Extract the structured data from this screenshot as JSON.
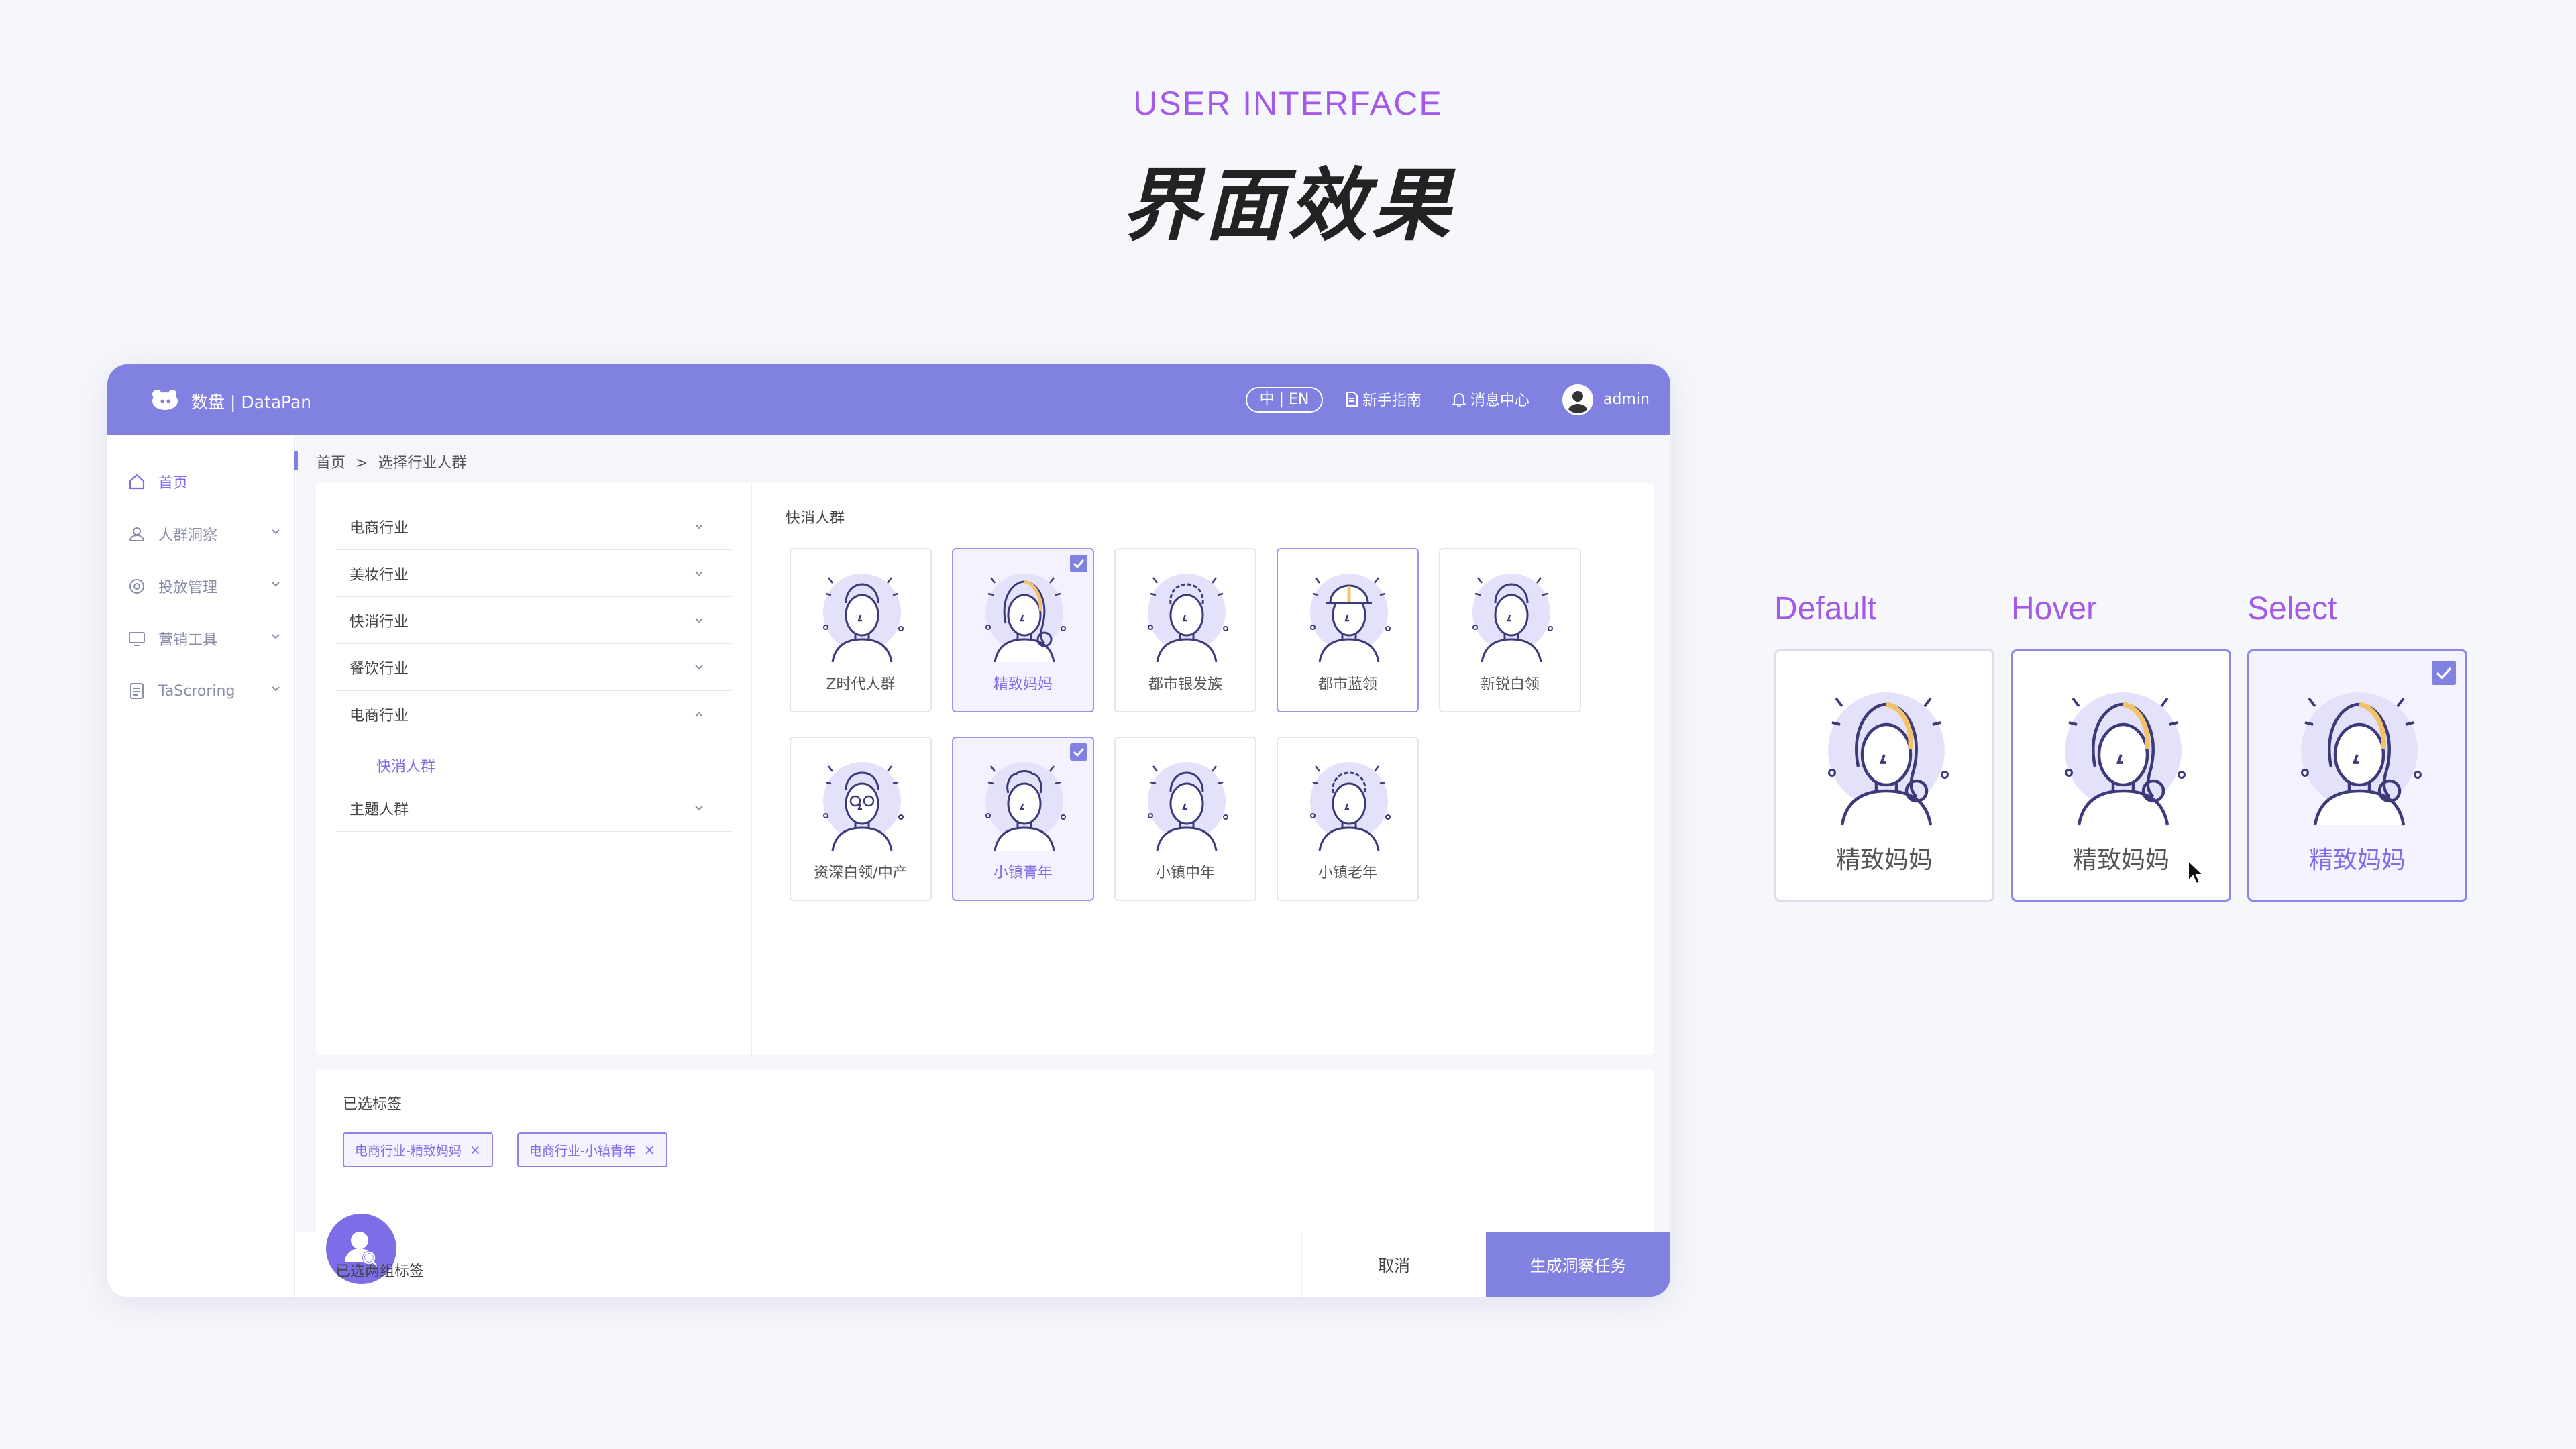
{
  "header": {
    "eyebrow": "USER INTERFACE",
    "title": "界面效果"
  },
  "app": {
    "brand": "数盘 | DataPan",
    "topbar": {
      "lang_label": "中 | EN",
      "guide_label": "新手指南",
      "messages_label": "消息中心",
      "user_name": "admin"
    },
    "sidebar": {
      "items": [
        {
          "label": "首页",
          "icon": "home-icon",
          "active": true
        },
        {
          "label": "人群洞察",
          "icon": "people-icon"
        },
        {
          "label": "投放管理",
          "icon": "target-icon"
        },
        {
          "label": "营销工具",
          "icon": "monitor-icon"
        },
        {
          "label": "TaScroring",
          "icon": "document-icon"
        }
      ]
    },
    "breadcrumb": {
      "home": "首页",
      "separator": ">",
      "current": "选择行业人群"
    },
    "industries": [
      {
        "label": "电商行业",
        "expanded": false
      },
      {
        "label": "美妆行业",
        "expanded": false
      },
      {
        "label": "快消行业",
        "expanded": false
      },
      {
        "label": "餐饮行业",
        "expanded": false
      },
      {
        "label": "电商行业",
        "expanded": true
      },
      {
        "label": "主题人群",
        "expanded": false
      }
    ],
    "sub_item": "快消人群",
    "group_title": "快消人群",
    "personas": [
      {
        "label": "Z时代人群",
        "state": "default"
      },
      {
        "label": "精致妈妈",
        "state": "selected"
      },
      {
        "label": "都市银发族",
        "state": "default"
      },
      {
        "label": "都市蓝领",
        "state": "hover"
      },
      {
        "label": "新锐白领",
        "state": "default"
      },
      {
        "label": "资深白领/中产",
        "state": "default"
      },
      {
        "label": "小镇青年",
        "state": "selected"
      },
      {
        "label": "小镇中年",
        "state": "default"
      },
      {
        "label": "小镇老年",
        "state": "default"
      }
    ],
    "selected_tags_title": "已选标签",
    "tags": [
      {
        "label": "电商行业-精致妈妈"
      },
      {
        "label": "电商行业-小镇青年"
      }
    ],
    "footer": {
      "summary": "已选两组标签",
      "cancel": "取消",
      "submit": "生成洞察任务"
    }
  },
  "states": {
    "default": {
      "title": "Default",
      "label": "精致妈妈"
    },
    "hover": {
      "title": "Hover",
      "label": "精致妈妈"
    },
    "select": {
      "title": "Select",
      "label": "精致妈妈"
    }
  },
  "colors": {
    "accent": "#8181e2",
    "accent_text": "#7d6ee8",
    "heading_purple": "#a45ae8",
    "highlight_yellow": "#f3c36b"
  }
}
